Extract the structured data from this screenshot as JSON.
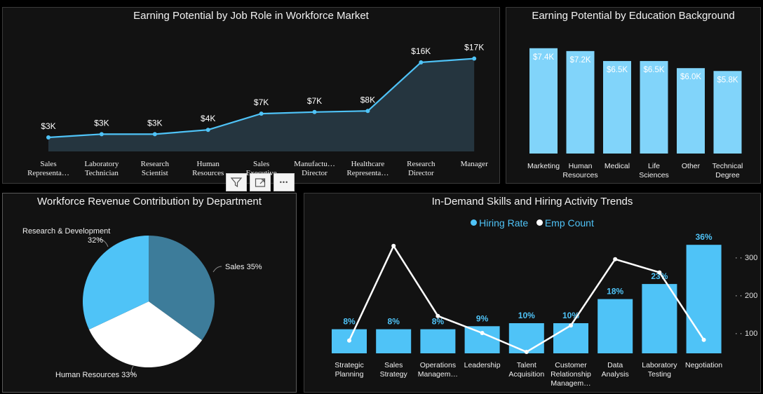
{
  "colors": {
    "accent": "#4fc3f7",
    "bar_light": "#81d4fa",
    "pie_dark": "#3d7c9a",
    "line_white": "#ffffff",
    "area": "#25353f"
  },
  "visual_header": {
    "filter_icon": "filter-icon",
    "focus_icon": "focus-mode-icon",
    "more_icon": "more-options-icon",
    "more_label": "•••"
  },
  "chart_data": [
    {
      "type": "area",
      "title": "Earning Potential by Job Role in Workforce Market",
      "categories": [
        "Sales Representa...",
        "Laboratory Technician",
        "Research Scientist",
        "Human Resources",
        "Sales Executive",
        "Manufactu... Director",
        "Healthcare Representa...",
        "Research Director",
        "Manager"
      ],
      "category_lines": [
        [
          "Sales",
          "Representa…"
        ],
        [
          "Laboratory",
          "Technician"
        ],
        [
          "Research",
          "Scientist"
        ],
        [
          "Human",
          "Resources"
        ],
        [
          "Sales",
          "Executive"
        ],
        [
          "Manufactu…",
          "Director"
        ],
        [
          "Healthcare",
          "Representa…"
        ],
        [
          "Research",
          "Director"
        ],
        [
          "Manager"
        ]
      ],
      "values": [
        2.6,
        3.2,
        3.2,
        4.0,
        7.0,
        7.3,
        7.5,
        16.5,
        17.2
      ],
      "data_labels": [
        "$3K",
        "$3K",
        "$3K",
        "$4K",
        "$7K",
        "$7K",
        "$8K",
        "$16K",
        "$17K"
      ],
      "ylim": [
        0,
        20
      ]
    },
    {
      "type": "bar",
      "title": "Earning Potential by Education Background",
      "categories": [
        "Marketing",
        "Human Resources",
        "Medical",
        "Life Sciences",
        "Other",
        "Technical Degree"
      ],
      "category_lines": [
        [
          "Marketing"
        ],
        [
          "Human",
          "Resources"
        ],
        [
          "Medical"
        ],
        [
          "Life",
          "Sciences"
        ],
        [
          "Other"
        ],
        [
          "Technical",
          "Degree"
        ]
      ],
      "values": [
        7.4,
        7.2,
        6.5,
        6.5,
        6.0,
        5.8
      ],
      "data_labels": [
        "$7.4K",
        "$7.2K",
        "$6.5K",
        "$6.5K",
        "$6.0K",
        "$5.8K"
      ],
      "ylim": [
        0,
        8
      ]
    },
    {
      "type": "pie",
      "title": "Workforce Revenue Contribution by Department",
      "slices": [
        {
          "label": "Sales 35%",
          "name": "Sales",
          "value": 35
        },
        {
          "label": "Human Resources 33%",
          "name": "Human Resources",
          "value": 33
        },
        {
          "label_line1": "Research & Development",
          "label_line2": "32%",
          "name": "Research & Development",
          "value": 32
        }
      ]
    },
    {
      "type": "bar",
      "title": "In-Demand Skills and Hiring Activity Trends",
      "legend": [
        "Hiring Rate",
        "Emp Count"
      ],
      "categories": [
        "Strategic Planning",
        "Sales Strategy",
        "Operations Managem...",
        "Leadership",
        "Talent Acquisition",
        "Customer Relationship Managem...",
        "Data Analysis",
        "Laboratory Testing",
        "Negotiation"
      ],
      "category_lines": [
        [
          "Strategic",
          "Planning"
        ],
        [
          "Sales",
          "Strategy"
        ],
        [
          "Operations",
          "Managem…"
        ],
        [
          "Leadership"
        ],
        [
          "Talent",
          "Acquisition"
        ],
        [
          "Customer",
          "Relationship",
          "Managem…"
        ],
        [
          "Data",
          "Analysis"
        ],
        [
          "Laboratory",
          "Testing"
        ],
        [
          "Negotiation"
        ]
      ],
      "series": [
        {
          "name": "Hiring Rate",
          "values": [
            8,
            8,
            8,
            9,
            10,
            10,
            18,
            23,
            36
          ],
          "labels": [
            "8%",
            "8%",
            "8%",
            "9%",
            "10%",
            "10%",
            "18%",
            "23%",
            "36%"
          ]
        },
        {
          "name": "Emp Count",
          "values": [
            80,
            330,
            145,
            100,
            50,
            120,
            295,
            260,
            82
          ]
        }
      ],
      "y2_ticks": [
        "100",
        "200",
        "300"
      ],
      "y2_tick_values": [
        100,
        200,
        300
      ]
    }
  ]
}
